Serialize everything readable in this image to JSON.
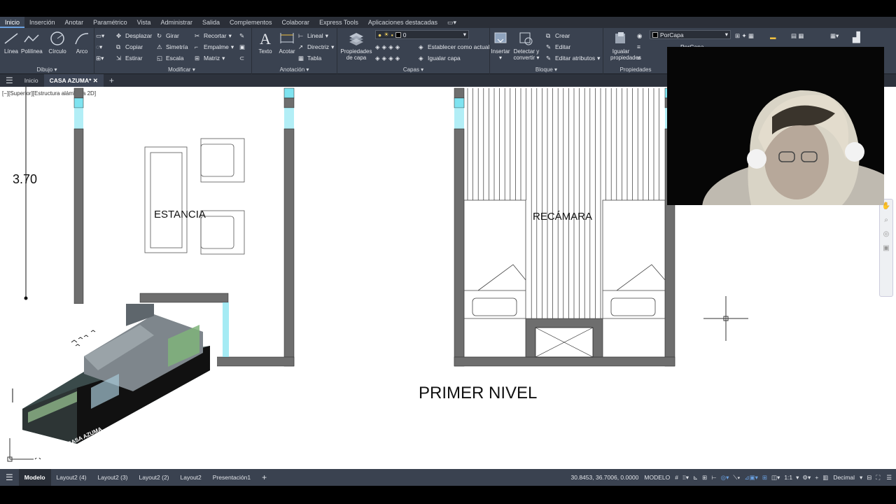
{
  "ribbon_tabs": [
    "Inicio",
    "Inserción",
    "Anotar",
    "Paramétrico",
    "Vista",
    "Administrar",
    "Salida",
    "Complementos",
    "Colaborar",
    "Express Tools",
    "Aplicaciones destacadas"
  ],
  "panels": {
    "dibujo": {
      "title": "Dibujo",
      "tools": [
        "Línea",
        "Polilínea",
        "Círculo",
        "Arco"
      ]
    },
    "modificar": {
      "title": "Modificar",
      "rows": [
        [
          "Desplazar",
          "Girar",
          "Recortar"
        ],
        [
          "Copiar",
          "Simetría",
          "Empalme"
        ],
        [
          "Estirar",
          "Escala",
          "Matriz"
        ]
      ]
    },
    "anotacion": {
      "title": "Anotación",
      "big": [
        "Texto",
        "Acotar"
      ],
      "small": [
        "Lineal",
        "Directriz",
        "Tabla"
      ]
    },
    "capas": {
      "title": "Capas",
      "prop_label_1": "Propiedades",
      "prop_label_2": "de capa",
      "layer_value": "0",
      "set_current": "Establecer como actual",
      "match_layer": "Igualar capa"
    },
    "bloque": {
      "title": "Bloque",
      "insert": "Insertar",
      "detect_1": "Detectar y",
      "detect_2": "convertir",
      "create": "Crear",
      "edit": "Editar",
      "edit_attr": "Editar atributos"
    },
    "propiedades": {
      "title": "Propiedades",
      "match_1": "Igualar",
      "match_2": "propiedades",
      "bylayer": "PorCapa",
      "bylayer2": "PorCapa"
    }
  },
  "doc_tabs": {
    "home": "Inicio",
    "active": "CASA AZUMA*"
  },
  "viewport_label": "[−][Superior][Estructura alámbrica 2D]",
  "drawing": {
    "dimension": "3.70",
    "room_left": "ESTANCIA",
    "room_right": "RECÁMARA",
    "level_title": "PRIMER NIVEL"
  },
  "thumbnail": {
    "caption": "CASA AZUMA"
  },
  "layout_tabs": [
    "Modelo",
    "Layout2 (4)",
    "Layout2 (3)",
    "Layout2 (2)",
    "Layout2",
    "Presentación1"
  ],
  "status": {
    "coordinates": "30.8453, 36.7006, 0.0000",
    "space": "MODELO",
    "scale": "1:1",
    "units": "Decimal"
  },
  "colors": {
    "ribbon": "#3a4250",
    "wall": "#6e6e6e",
    "glass": "#7fe3f0",
    "canvas": "#ffffff"
  }
}
